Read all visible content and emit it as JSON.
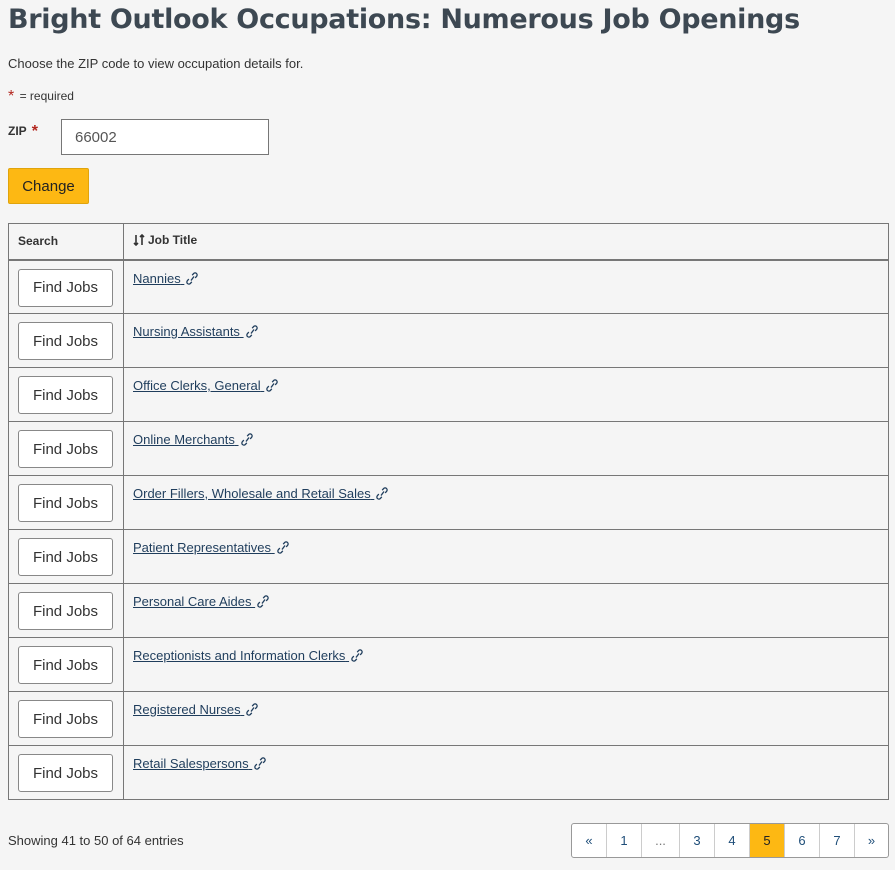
{
  "page": {
    "title": "Bright Outlook Occupations: Numerous Job Openings",
    "instructions": "Choose the ZIP code to view occupation details for.",
    "required_star": "*",
    "required_note": "= required"
  },
  "form": {
    "zip_label": "ZIP",
    "zip_required": "*",
    "zip_value": "66002",
    "change_label": "Change"
  },
  "table": {
    "col_search": "Search",
    "col_job_title": "Job Title",
    "sort_icon": "sort-icon",
    "link_icon": "link-icon",
    "rows": [
      {
        "button": "Find Jobs",
        "title": "Nannies"
      },
      {
        "button": "Find Jobs",
        "title": "Nursing Assistants"
      },
      {
        "button": "Find Jobs",
        "title": "Office Clerks, General"
      },
      {
        "button": "Find Jobs",
        "title": "Online Merchants"
      },
      {
        "button": "Find Jobs",
        "title": "Order Fillers, Wholesale and Retail Sales"
      },
      {
        "button": "Find Jobs",
        "title": "Patient Representatives"
      },
      {
        "button": "Find Jobs",
        "title": "Personal Care Aides"
      },
      {
        "button": "Find Jobs",
        "title": "Receptionists and Information Clerks"
      },
      {
        "button": "Find Jobs",
        "title": "Registered Nurses"
      },
      {
        "button": "Find Jobs",
        "title": "Retail Salespersons"
      }
    ]
  },
  "footer": {
    "showing": "Showing 41 to 50 of 64 entries",
    "pagination": [
      {
        "label": "«",
        "type": "prev"
      },
      {
        "label": "1",
        "type": "page"
      },
      {
        "label": "...",
        "type": "ellipsis"
      },
      {
        "label": "3",
        "type": "page"
      },
      {
        "label": "4",
        "type": "page"
      },
      {
        "label": "5",
        "type": "page",
        "active": true
      },
      {
        "label": "6",
        "type": "page"
      },
      {
        "label": "7",
        "type": "page"
      },
      {
        "label": "»",
        "type": "next"
      }
    ]
  },
  "colors": {
    "accent": "#fdb813",
    "title": "#3d4852",
    "link": "#1f3d5c",
    "required": "#b3261e"
  }
}
